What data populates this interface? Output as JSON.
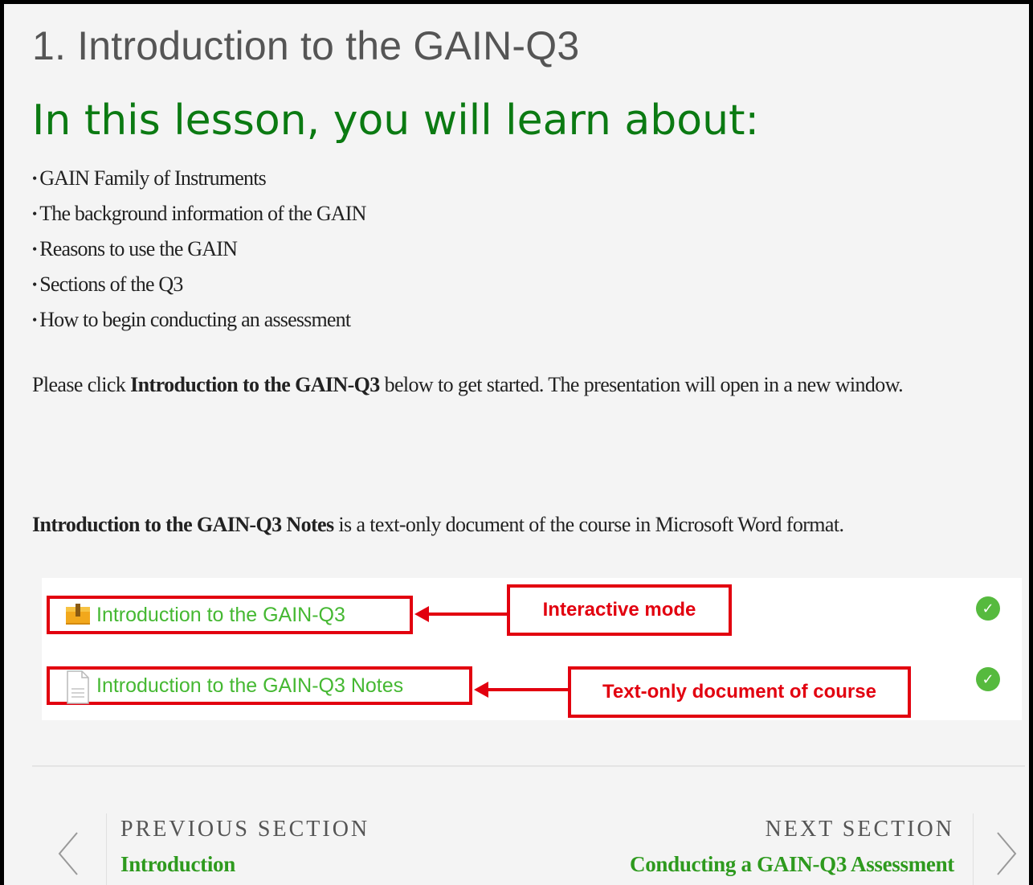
{
  "page": {
    "title": "1. Introduction to the GAIN-Q3",
    "lesson_heading": "In this lesson, you will learn about:"
  },
  "objectives": [
    "GAIN Family of Instruments",
    "The background information of the GAIN",
    "Reasons to use the GAIN",
    "Sections of the Q3",
    "How to begin conducting an assessment"
  ],
  "intro": {
    "prefix": "Please click ",
    "bold": "Introduction to the GAIN-Q3",
    "suffix": " below to get started. The presentation will open in a new window."
  },
  "notes": {
    "bold": "Introduction to the GAIN-Q3 Notes",
    "suffix": " is a text-only document of the course in Microsoft Word format."
  },
  "activities": [
    {
      "label": "Introduction to the GAIN-Q3",
      "icon": "package-icon",
      "completed": true
    },
    {
      "label": "Introduction to the GAIN-Q3 Notes",
      "icon": "document-icon",
      "completed": true
    }
  ],
  "callouts": {
    "interactive": "Interactive mode",
    "text_only": "Text-only document of course"
  },
  "navigation": {
    "previous_label": "Previous Section",
    "previous_link": "Introduction",
    "next_label": "Next Section",
    "next_link": "Conducting a GAIN-Q3 Assessment"
  },
  "colors": {
    "accent_green": "#0b7a12",
    "link_green": "#45b832",
    "annotation_red": "#e2000f",
    "check_green": "#56ba3e"
  }
}
